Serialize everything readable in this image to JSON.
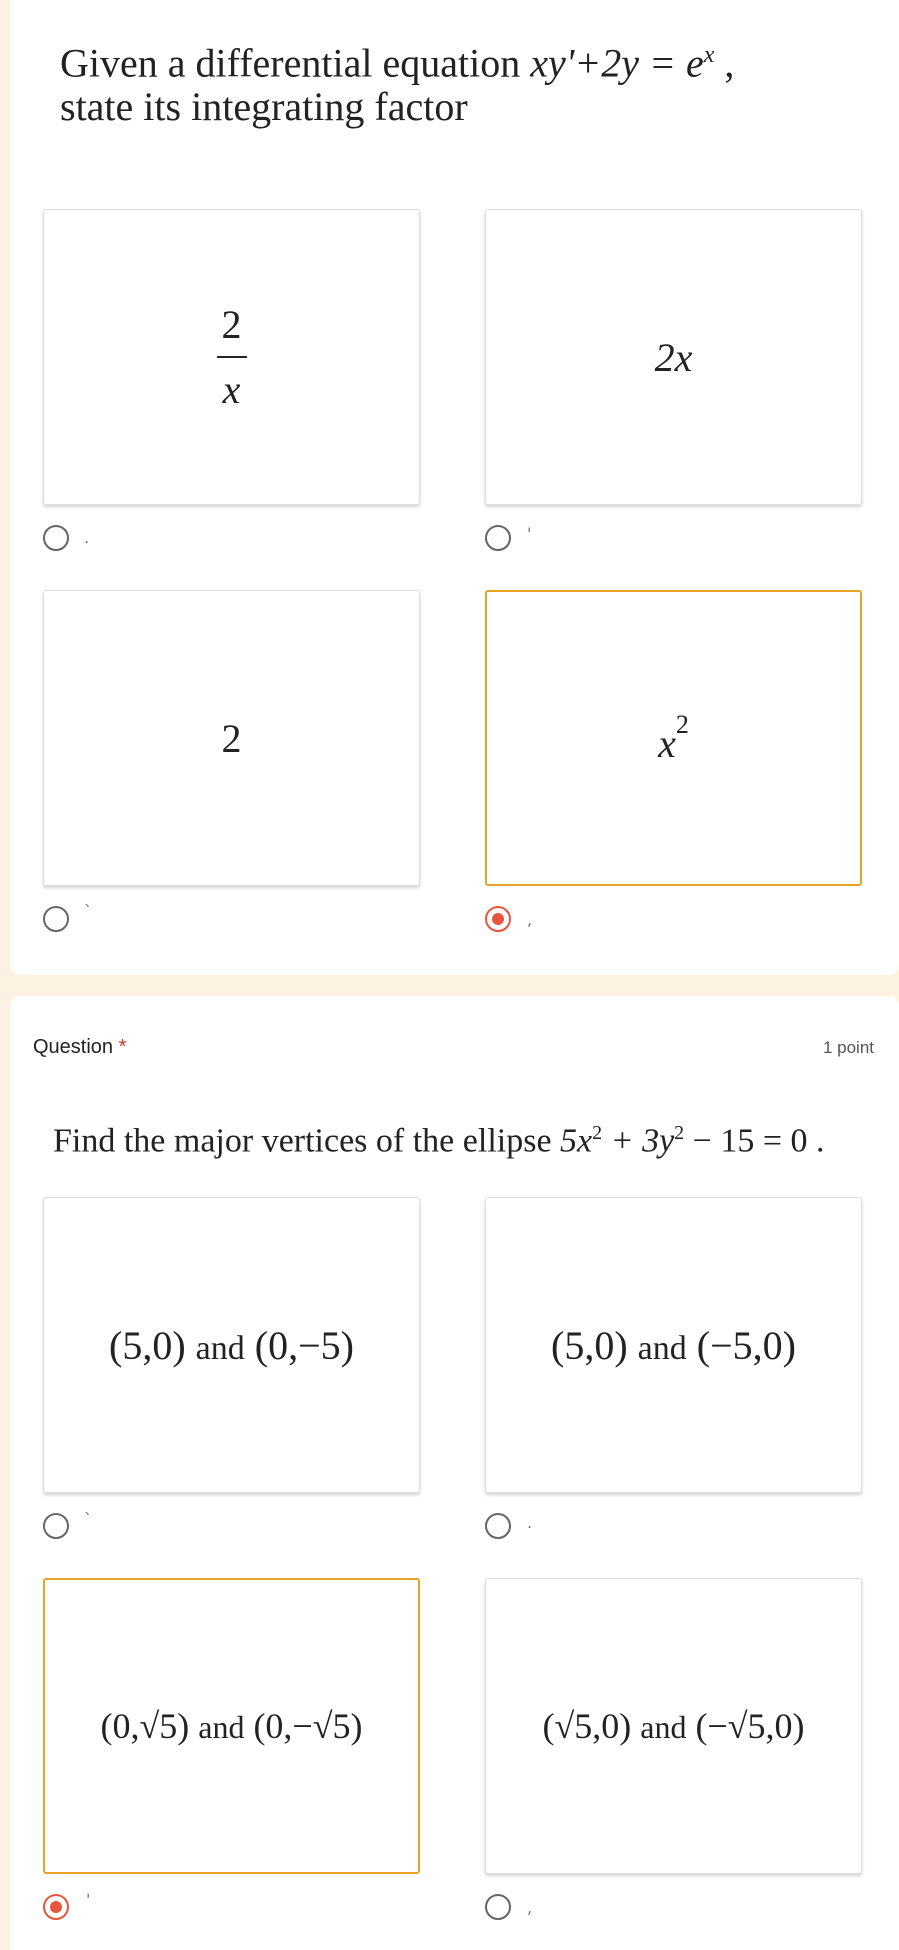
{
  "q1": {
    "text_line1": "Given a differential equation ",
    "equation": "xy'+2y = e",
    "equation_sup": "x",
    "text_line2": "state its integrating factor",
    "options": [
      {
        "num": "2",
        "den": "x",
        "selected": false,
        "tick": "."
      },
      {
        "label": "2x",
        "selected": false,
        "tick": "'"
      },
      {
        "label": "2",
        "selected": false,
        "tick": "`"
      },
      {
        "base": "x",
        "sup": "2",
        "selected": true,
        "tick": ","
      }
    ]
  },
  "q2": {
    "label": "Question",
    "required_mark": "*",
    "points": "1 point",
    "text": "Find the major vertices of the ellipse ",
    "equation_a": "5x",
    "equation_b": " + 3y",
    "equation_c": " − 15 = 0 .",
    "options": [
      {
        "p1": "(5,0)",
        "and": "and",
        "p2": "(0,−5)",
        "selected": false,
        "tick": "`"
      },
      {
        "p1": "(5,0)",
        "and": "and",
        "p2": "(−5,0)",
        "selected": false,
        "tick": "."
      },
      {
        "p1": "(0,√5)",
        "and": "and",
        "p2": "(0,−√5)",
        "selected": true,
        "tick": "'"
      },
      {
        "p1": "(√5,0)",
        "and": "and",
        "p2": "(−√5,0)",
        "selected": false,
        "tick": ","
      }
    ]
  },
  "colors": {
    "accent": "#e8553f",
    "selected_border": "#e6a326",
    "background": "#fdf1e1"
  }
}
